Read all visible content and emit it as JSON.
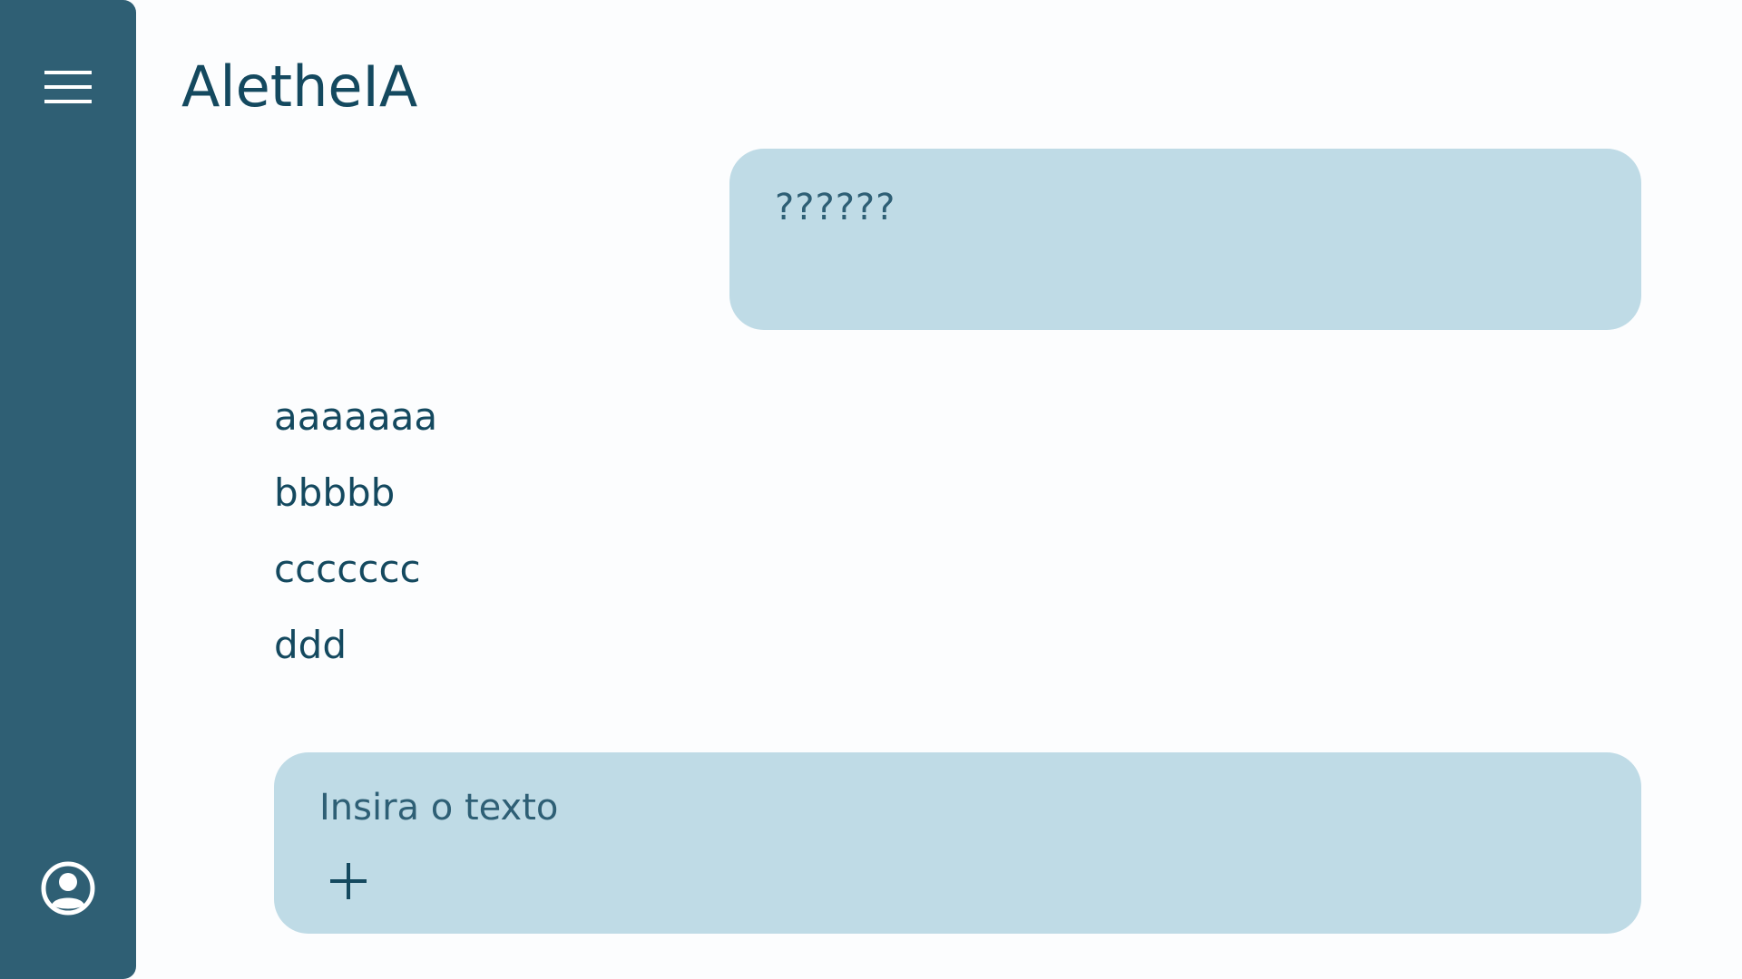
{
  "app": {
    "title": "AletheIA"
  },
  "sidebar": {
    "menu_icon": "hamburger-menu-icon",
    "user_icon": "user-account-icon"
  },
  "chat": {
    "user_message": "??????",
    "response_lines": [
      "aaaaaaa",
      "bbbbb",
      "ccccccc",
      "ddd"
    ]
  },
  "composer": {
    "placeholder": "Insira o texto",
    "add_icon": "plus-icon"
  },
  "colors": {
    "sidebar": "#2f5f74",
    "bubble": "#bfdbe6",
    "text": "#14495f",
    "background": "#fcfdfe"
  }
}
